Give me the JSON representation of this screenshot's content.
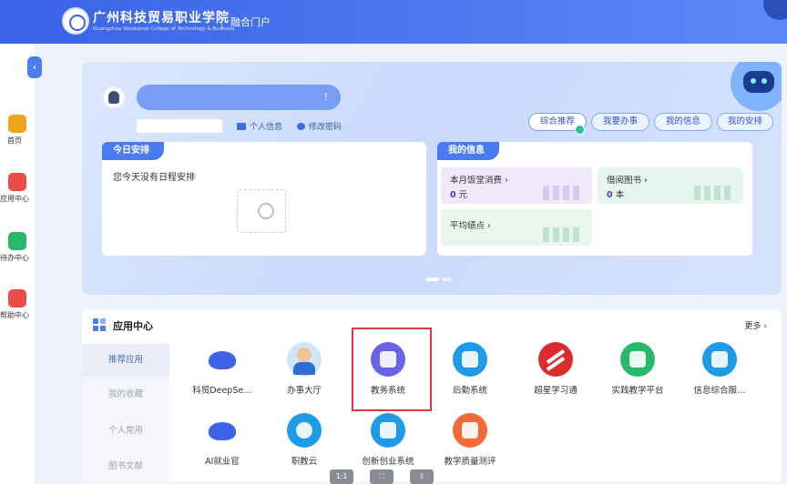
{
  "header": {
    "school_name": "广州科技贸易职业学院",
    "school_name_en": "Guangzhou Vocational College of Technology & Business",
    "portal": "融合门户"
  },
  "sidebar": {
    "items": [
      {
        "label": "首页",
        "icon": "home-icon",
        "color": "#f2a21c"
      },
      {
        "label": "应用中心",
        "icon": "apps-icon",
        "color": "#ee4c4c"
      },
      {
        "label": "待办中心",
        "icon": "todo-icon",
        "color": "#27b96a"
      },
      {
        "label": "帮助中心",
        "icon": "help-icon",
        "color": "#ee4c4c"
      }
    ]
  },
  "hero": {
    "greeting_suffix": "!",
    "profile_link": "个人信息",
    "change_password_link": "修改密码",
    "pills": [
      "综合推荐",
      "我要办事",
      "我的信息",
      "我的安排"
    ]
  },
  "schedule": {
    "title": "今日安排",
    "empty_text": "您今天没有日程安排"
  },
  "my_info": {
    "title": "我的信息",
    "tiles": [
      {
        "label": "本月饭堂消费",
        "value": "0",
        "unit": "元",
        "color": "#efe9fb"
      },
      {
        "label": "借阅图书",
        "value": "0",
        "unit": "本",
        "color": "#e6f6ee"
      },
      {
        "label": "平均绩点",
        "value": "",
        "unit": "",
        "color": "#e8f6ee"
      }
    ]
  },
  "apps": {
    "title": "应用中心",
    "more": "更多",
    "tabs": [
      "推荐应用",
      "我的收藏",
      "个人常用",
      "图书文献"
    ],
    "items": [
      {
        "label": "科贸DeepSe…",
        "icon": "whale-icon",
        "color": "#3f63e8"
      },
      {
        "label": "办事大厅",
        "icon": "service-hall-icon",
        "color": "#5aa9e6"
      },
      {
        "label": "教务系统",
        "icon": "academic-icon",
        "color": "#6b63e6"
      },
      {
        "label": "后勤系统",
        "icon": "logistics-icon",
        "color": "#1e9be8"
      },
      {
        "label": "超星学习通",
        "icon": "chaoxing-icon",
        "color": "#d92d2d"
      },
      {
        "label": "实践教学平台",
        "icon": "practice-icon",
        "color": "#27b96a"
      },
      {
        "label": "信息综合服…",
        "icon": "info-service-icon",
        "color": "#1e9be8"
      },
      {
        "label": "AI就业官",
        "icon": "whale-icon",
        "color": "#3f63e8"
      },
      {
        "label": "职教云",
        "icon": "cloud-icon",
        "color": "#1e9be8"
      },
      {
        "label": "创新创业系统",
        "icon": "folder-icon",
        "color": "#1e9be8"
      },
      {
        "label": "教学质量测评",
        "icon": "evaluation-icon",
        "color": "#f06a3a"
      }
    ]
  },
  "toolbar": [
    "1:1",
    "fit",
    "download"
  ]
}
